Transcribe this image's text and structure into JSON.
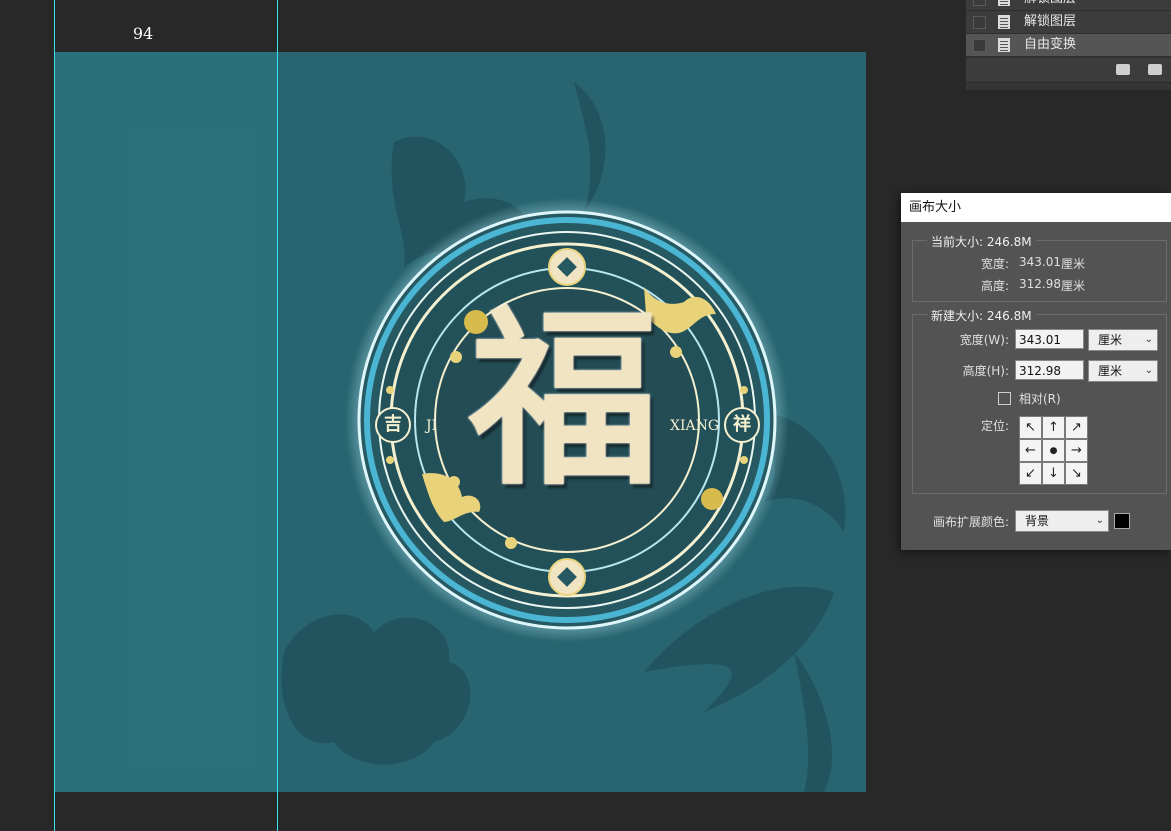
{
  "ruler": {
    "readout": "94"
  },
  "canvas_art": {
    "main_glyph": "福",
    "left_coin": "吉",
    "right_coin": "祥",
    "left_text": "JI",
    "right_text": "XIANG",
    "colors": {
      "canvas_bg": "#286570",
      "gold": "#e8d27a",
      "cream": "#f1e4c3",
      "ring_blue": "#4ab6d4"
    }
  },
  "history": {
    "items": [
      {
        "label": "解锁图层",
        "active": false
      },
      {
        "label": "解锁图层",
        "active": false
      },
      {
        "label": "自由变换",
        "active": true
      }
    ],
    "footer_icons": [
      "new-snapshot-icon",
      "camera-icon"
    ]
  },
  "dialog": {
    "title": "画布大小",
    "current": {
      "label": "当前大小: 246.8M",
      "width_label": "宽度:",
      "width_value": "343.01",
      "width_unit": "厘米",
      "height_label": "高度:",
      "height_value": "312.98",
      "height_unit": "厘米"
    },
    "new": {
      "label": "新建大小: 246.8M",
      "width_label": "宽度(W):",
      "width_value": "343.01",
      "width_unit": "厘米",
      "height_label": "高度(H):",
      "height_value": "312.98",
      "height_unit": "厘米",
      "relative_label": "相对(R)",
      "relative_checked": false,
      "anchor_label": "定位:",
      "anchor_arrows": [
        "↖",
        "↑",
        "↗",
        "←",
        "●",
        "→",
        "↙",
        "↓",
        "↘"
      ]
    },
    "extension_label": "画布扩展颜色:",
    "extension_value": "背景",
    "extension_swatch": "#000000"
  }
}
